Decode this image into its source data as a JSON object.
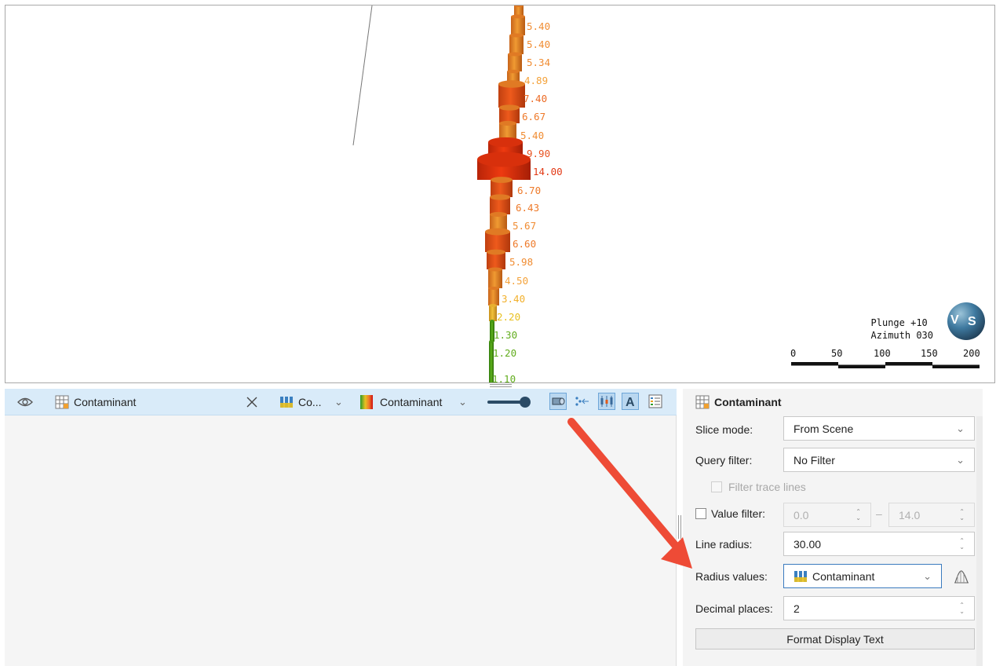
{
  "viewport": {
    "value_labels": [
      {
        "text": "5.40",
        "color": "#f08c32"
      },
      {
        "text": "5.40",
        "color": "#f08c32"
      },
      {
        "text": "5.34",
        "color": "#f08c32"
      },
      {
        "text": "4.89",
        "color": "#f4a23a"
      },
      {
        "text": "7.40",
        "color": "#ec6b25"
      },
      {
        "text": "6.67",
        "color": "#ee7a2a"
      },
      {
        "text": "5.40",
        "color": "#f08c32"
      },
      {
        "text": "9.90",
        "color": "#e85321"
      },
      {
        "text": "14.00",
        "color": "#e23a16"
      },
      {
        "text": "6.70",
        "color": "#ee7a2a"
      },
      {
        "text": "6.43",
        "color": "#ee7a2a"
      },
      {
        "text": "5.67",
        "color": "#f08c32"
      },
      {
        "text": "6.60",
        "color": "#ee7a2a"
      },
      {
        "text": "5.98",
        "color": "#f08c32"
      },
      {
        "text": "4.50",
        "color": "#f4a23a"
      },
      {
        "text": "3.40",
        "color": "#f2b02c"
      },
      {
        "text": "2.20",
        "color": "#e8c020"
      },
      {
        "text": "1.30",
        "color": "#62ad1e"
      },
      {
        "text": "1.20",
        "color": "#62ad1e"
      },
      {
        "text": "1.10",
        "color": "#62ad1e"
      }
    ],
    "orientation": {
      "plunge": "Plunge +10",
      "azimuth": "Azimuth 030"
    },
    "globe": {
      "left": "V",
      "right": "S"
    },
    "scale": [
      "0",
      "50",
      "100",
      "150",
      "200"
    ]
  },
  "layer_row": {
    "layer_name": "Contaminant",
    "column_short": "Co...",
    "colourmap_name": "Contaminant",
    "icons": [
      "eye-icon",
      "table-icon",
      "close-icon",
      "columns-icon",
      "gradient-icon",
      "slider-icon",
      "radius-icon",
      "points-icon",
      "candlestick-icon",
      "text-label-icon",
      "legend-icon"
    ],
    "colors": {
      "row_bg": "#d9ebf9",
      "active_btn": "#b9d7f0"
    }
  },
  "properties": {
    "title": "Contaminant",
    "slice_mode": {
      "label": "Slice mode:",
      "value": "From Scene"
    },
    "query_filter": {
      "label": "Query filter:",
      "value": "No Filter"
    },
    "filter_trace_lines": {
      "label": "Filter trace lines",
      "enabled": false
    },
    "value_filter": {
      "label": "Value filter:",
      "min": "0.0",
      "dash": "–",
      "max": "14.0",
      "checked": false
    },
    "line_radius": {
      "label": "Line radius:",
      "value": "30.00"
    },
    "radius_values": {
      "label": "Radius values:",
      "value": "Contaminant"
    },
    "decimal_places": {
      "label": "Decimal places:",
      "value": "2"
    },
    "format_button": "Format Display Text"
  },
  "accent_colors": {
    "arrow": "#ee4b36",
    "focus_border": "#3b7bbf"
  }
}
